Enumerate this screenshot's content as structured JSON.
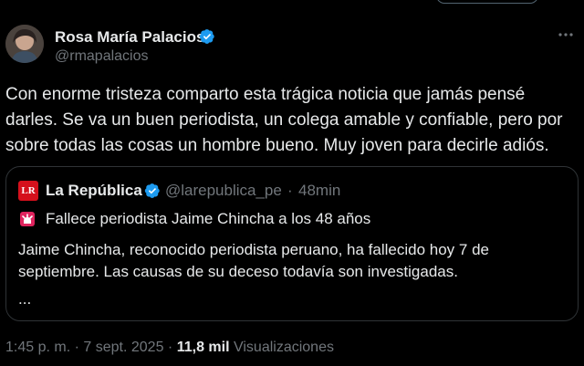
{
  "author": {
    "name": "Rosa María Palacios",
    "handle": "@rmapalacios",
    "verified": true,
    "verified_color": "#1d9bf0"
  },
  "tweet": {
    "text": "Con enorme tristeza comparto esta trágica noticia que jamás pensé\ndarles. Se va un buen periodista, un colega amable y confiable, pero por\nsobre todas las cosas un hombre bueno. Muy joven para decirle adiós."
  },
  "quote": {
    "logo_text": "LR",
    "name": "La República",
    "handle": "@larepublica_pe",
    "separator": "·",
    "time": "48min",
    "headline_icon": "siren-icon",
    "headline": "Fallece periodista Jaime Chincha a los 48 años",
    "body": "Jaime Chincha, reconocido periodista peruano, ha fallecido hoy 7 de septiembre. Las causas de su deceso todavía son investigadas.",
    "more": "..."
  },
  "meta": {
    "time": "1:45 p. m.",
    "date": "7 sept. 2025",
    "separator": "·",
    "views_count": "11,8 mil",
    "views_label": "Visualizaciones"
  },
  "icons": {
    "more": "ellipsis-icon",
    "verified": "verified-badge-icon"
  }
}
